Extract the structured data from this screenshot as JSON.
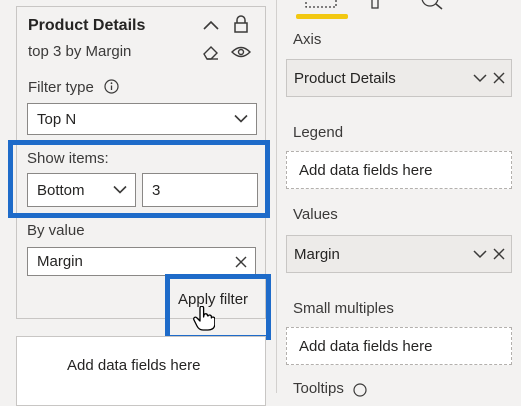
{
  "filter_card": {
    "title": "Product Details",
    "subtitle": "top 3 by Margin",
    "filter_type_label": "Filter type",
    "filter_type_value": "Top N",
    "show_items_label": "Show items:",
    "show_items_direction": "Bottom",
    "show_items_count": "3",
    "by_value_label": "By value",
    "by_value_field": "Margin",
    "apply_label": "Apply filter"
  },
  "filter_card_2": {
    "placeholder": "Add data fields here"
  },
  "build_pane": {
    "axis": {
      "title": "Axis",
      "field": "Product Details"
    },
    "legend": {
      "title": "Legend",
      "placeholder": "Add data fields here"
    },
    "values": {
      "title": "Values",
      "field": "Margin"
    },
    "small_multiples": {
      "title": "Small multiples",
      "placeholder": "Add data fields here"
    },
    "tooltips": {
      "title": "Tooltips"
    }
  },
  "colors": {
    "highlight": "#1e6bc9",
    "tab_accent": "#f2c811"
  },
  "icons": [
    "chevron-up-icon",
    "lock-icon",
    "eraser-icon",
    "eye-icon",
    "info-icon",
    "chevron-down-icon",
    "clear-icon",
    "cursor-hand-icon"
  ]
}
